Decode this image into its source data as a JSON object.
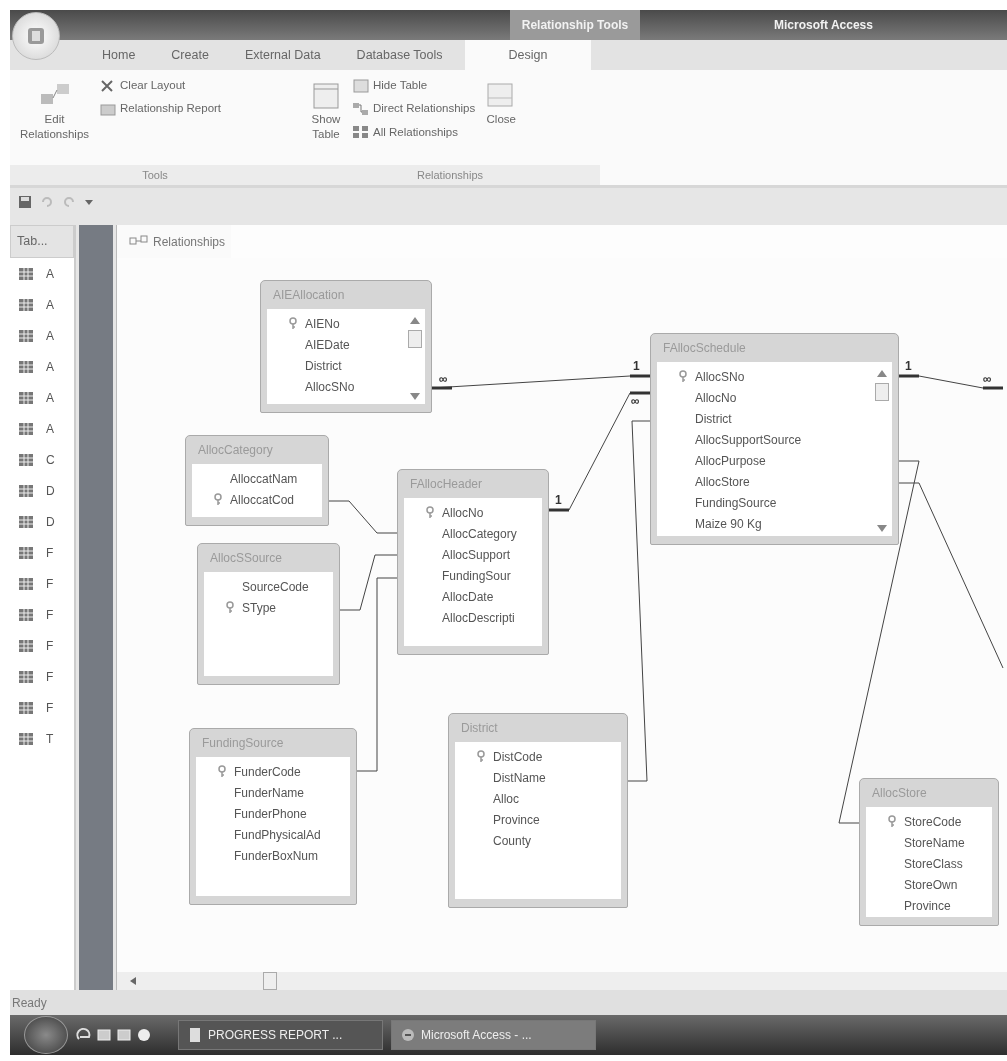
{
  "window": {
    "contextual_tab_group": "Relationship Tools",
    "title": "Microsoft Access"
  },
  "ribbon_tabs": [
    {
      "label": "Home",
      "selected": false
    },
    {
      "label": "Create",
      "selected": false
    },
    {
      "label": "External Data",
      "selected": false
    },
    {
      "label": "Database Tools",
      "selected": false
    },
    {
      "label": "Design",
      "selected": true
    }
  ],
  "ribbon_groups": [
    {
      "label": "Tools",
      "commands": [
        {
          "label": "Edit Relationships",
          "kind": "large"
        },
        {
          "label": "Clear Layout",
          "kind": "small"
        },
        {
          "label": "Relationship Report",
          "kind": "small"
        }
      ]
    },
    {
      "label": "Relationships",
      "commands": [
        {
          "label": "Show Table",
          "kind": "large"
        },
        {
          "label": "Hide Table",
          "kind": "small"
        },
        {
          "label": "Direct Relationships",
          "kind": "small"
        },
        {
          "label": "All Relationships",
          "kind": "small"
        },
        {
          "label": "Close",
          "kind": "large"
        }
      ]
    }
  ],
  "navigation_pane": {
    "header": "Tab...",
    "items": [
      "A",
      "A",
      "A",
      "A",
      "A",
      "A",
      "C",
      "D",
      "D",
      "F",
      "F",
      "F",
      "F",
      "F",
      "F",
      "T"
    ]
  },
  "document": {
    "tab": "Relationships"
  },
  "tables": [
    {
      "name": "AIEAllocation",
      "scrollbar": true,
      "fields": [
        {
          "name": "AIENo",
          "primary_key": true
        },
        {
          "name": "AIEDate",
          "primary_key": false
        },
        {
          "name": "District",
          "primary_key": false
        },
        {
          "name": "AllocSNo",
          "primary_key": false
        }
      ]
    },
    {
      "name": "AllocCategory",
      "scrollbar": false,
      "fields": [
        {
          "name": "AlloccatNam",
          "primary_key": false
        },
        {
          "name": "AlloccatCod",
          "primary_key": true
        }
      ]
    },
    {
      "name": "AllocSSource",
      "scrollbar": false,
      "fields": [
        {
          "name": "SourceCode",
          "primary_key": false
        },
        {
          "name": "SType",
          "primary_key": true
        }
      ]
    },
    {
      "name": "FAllocHeader",
      "scrollbar": false,
      "fields": [
        {
          "name": "AllocNo",
          "primary_key": true
        },
        {
          "name": "AllocCategory",
          "primary_key": false
        },
        {
          "name": "AllocSupport",
          "primary_key": false
        },
        {
          "name": "FundingSour",
          "primary_key": false
        },
        {
          "name": "AllocDate",
          "primary_key": false
        },
        {
          "name": "AllocDescripti",
          "primary_key": false
        }
      ]
    },
    {
      "name": "FAllocSchedule",
      "scrollbar": true,
      "fields": [
        {
          "name": "AllocSNo",
          "primary_key": true
        },
        {
          "name": "AllocNo",
          "primary_key": false
        },
        {
          "name": "District",
          "primary_key": false
        },
        {
          "name": "AllocSupportSource",
          "primary_key": false
        },
        {
          "name": "AllocPurpose",
          "primary_key": false
        },
        {
          "name": "AllocStore",
          "primary_key": false
        },
        {
          "name": "FundingSource",
          "primary_key": false
        },
        {
          "name": "Maize 90 Kg",
          "primary_key": false
        }
      ]
    },
    {
      "name": "FundingSource",
      "scrollbar": false,
      "fields": [
        {
          "name": "FunderCode",
          "primary_key": true
        },
        {
          "name": "FunderName",
          "primary_key": false
        },
        {
          "name": "FunderPhone",
          "primary_key": false
        },
        {
          "name": "FundPhysicalAd",
          "primary_key": false
        },
        {
          "name": "FunderBoxNum",
          "primary_key": false
        }
      ]
    },
    {
      "name": "District",
      "scrollbar": false,
      "fields": [
        {
          "name": "DistCode",
          "primary_key": true
        },
        {
          "name": "DistName",
          "primary_key": false
        },
        {
          "name": "Alloc",
          "primary_key": false
        },
        {
          "name": "Province",
          "primary_key": false
        },
        {
          "name": "County",
          "primary_key": false
        }
      ]
    },
    {
      "name": "AllocStore",
      "scrollbar": false,
      "fields": [
        {
          "name": "StoreCode",
          "primary_key": true
        },
        {
          "name": "StoreName",
          "primary_key": false
        },
        {
          "name": "StoreClass",
          "primary_key": false
        },
        {
          "name": "StoreOwn",
          "primary_key": false
        },
        {
          "name": "Province",
          "primary_key": false
        }
      ]
    }
  ],
  "relationships": [
    {
      "kind": "one_to_many",
      "ends": [
        "∞",
        "1"
      ]
    },
    {
      "kind": "one_to_many",
      "ends": [
        "1",
        "∞"
      ]
    },
    {
      "kind": "one_to_many",
      "ends": [
        "1",
        "∞"
      ]
    },
    {
      "kind": "plain"
    },
    {
      "kind": "plain"
    },
    {
      "kind": "plain"
    },
    {
      "kind": "plain"
    },
    {
      "kind": "plain"
    },
    {
      "kind": "plain"
    }
  ],
  "status_bar": {
    "text": "Ready"
  },
  "taskbar": {
    "buttons": [
      {
        "label": "PROGRESS REPORT ...",
        "selected": false
      },
      {
        "label": "Microsoft Access - ...",
        "selected": true
      }
    ]
  }
}
